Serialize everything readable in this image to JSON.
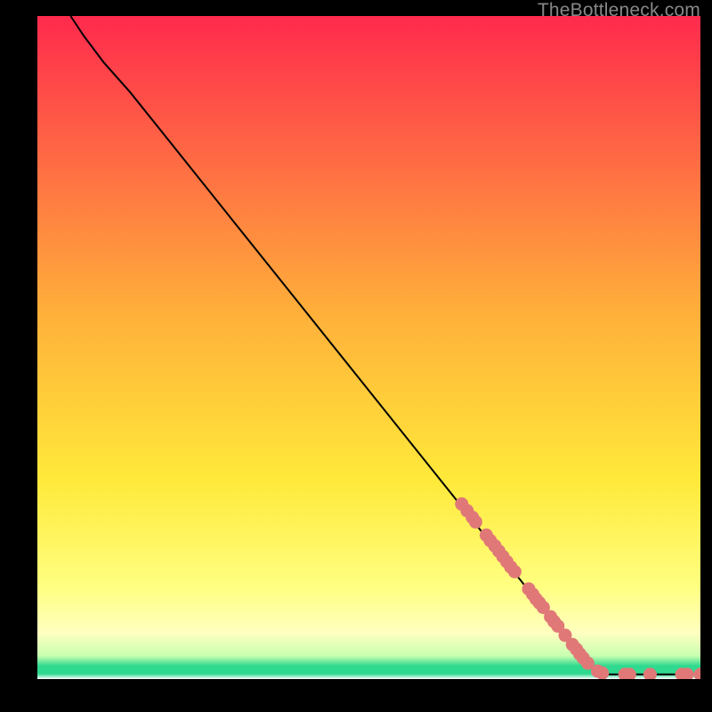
{
  "watermark": "TheBottleneck.com",
  "colors": {
    "gradient_top": "#ff2a4d",
    "gradient_mid1": "#ff9a3a",
    "gradient_mid2": "#ffe93a",
    "gradient_mid3": "#ffff80",
    "gradient_low": "#30d990",
    "gradient_bottom": "#ffffff",
    "line": "#000000",
    "marker": "#e07878"
  },
  "chart_data": {
    "type": "line",
    "title": "",
    "xlabel": "",
    "ylabel": "",
    "xlim": [
      0,
      100
    ],
    "ylim": [
      0,
      100
    ],
    "curve": [
      {
        "x": 5,
        "y": 100
      },
      {
        "x": 7,
        "y": 97
      },
      {
        "x": 10,
        "y": 93
      },
      {
        "x": 14,
        "y": 88.5
      },
      {
        "x": 20,
        "y": 81
      },
      {
        "x": 30,
        "y": 68.5
      },
      {
        "x": 40,
        "y": 56
      },
      {
        "x": 50,
        "y": 43.5
      },
      {
        "x": 60,
        "y": 31
      },
      {
        "x": 70,
        "y": 18.5
      },
      {
        "x": 80,
        "y": 6
      },
      {
        "x": 84,
        "y": 1.2
      },
      {
        "x": 86,
        "y": 0.7
      },
      {
        "x": 100,
        "y": 0.7
      }
    ],
    "markers": [
      {
        "x": 64,
        "y": 26.4
      },
      {
        "x": 64.8,
        "y": 25.4
      },
      {
        "x": 65.6,
        "y": 24.4
      },
      {
        "x": 66.1,
        "y": 23.7
      },
      {
        "x": 67.7,
        "y": 21.7
      },
      {
        "x": 68.3,
        "y": 20.9
      },
      {
        "x": 69.0,
        "y": 20.1
      },
      {
        "x": 69.6,
        "y": 19.3
      },
      {
        "x": 70.2,
        "y": 18.5
      },
      {
        "x": 70.8,
        "y": 17.7
      },
      {
        "x": 71.4,
        "y": 16.9
      },
      {
        "x": 72.0,
        "y": 16.2
      },
      {
        "x": 74.1,
        "y": 13.6
      },
      {
        "x": 74.7,
        "y": 12.8
      },
      {
        "x": 75.2,
        "y": 12.1
      },
      {
        "x": 75.7,
        "y": 11.5
      },
      {
        "x": 76.3,
        "y": 10.8
      },
      {
        "x": 77.4,
        "y": 9.4
      },
      {
        "x": 77.9,
        "y": 8.7
      },
      {
        "x": 78.5,
        "y": 8.0
      },
      {
        "x": 79.6,
        "y": 6.6
      },
      {
        "x": 80.7,
        "y": 5.2
      },
      {
        "x": 81.3,
        "y": 4.5
      },
      {
        "x": 81.8,
        "y": 3.8
      },
      {
        "x": 82.3,
        "y": 3.2
      },
      {
        "x": 83.0,
        "y": 2.4
      },
      {
        "x": 84.5,
        "y": 1.2
      },
      {
        "x": 85.2,
        "y": 0.9
      },
      {
        "x": 88.6,
        "y": 0.7
      },
      {
        "x": 89.3,
        "y": 0.7
      },
      {
        "x": 92.4,
        "y": 0.7
      },
      {
        "x": 97.2,
        "y": 0.7
      },
      {
        "x": 98.0,
        "y": 0.7
      },
      {
        "x": 100.0,
        "y": 0.7
      }
    ]
  }
}
